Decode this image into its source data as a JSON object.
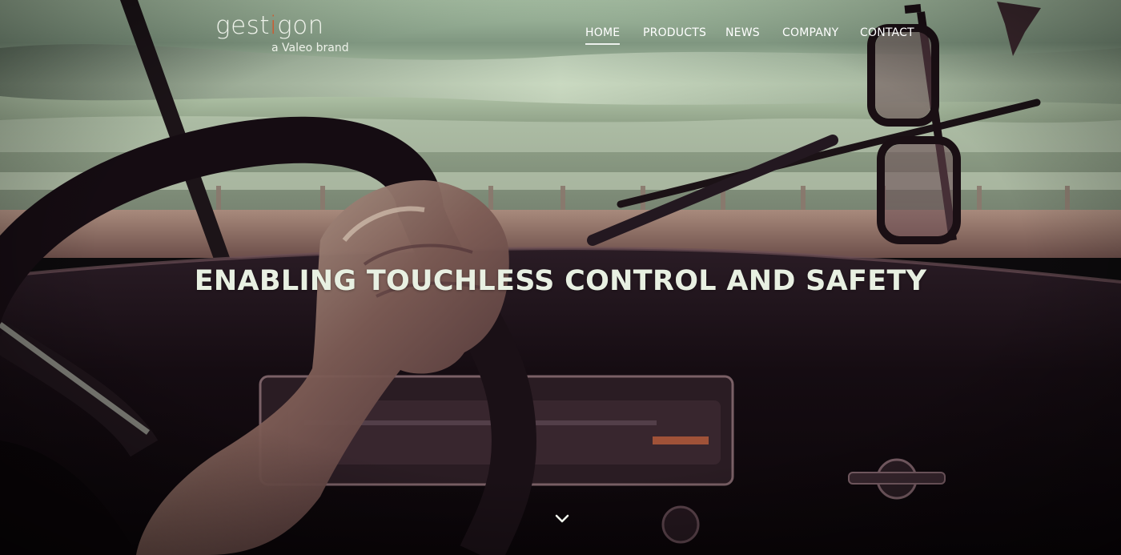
{
  "logo": {
    "word_start": "gest",
    "word_accent": "i",
    "word_end": "gon",
    "subtitle": "a Valeo brand"
  },
  "nav": {
    "items": [
      {
        "label": "HOME",
        "active": true
      },
      {
        "label": "PRODUCTS",
        "active": false
      },
      {
        "label": "NEWS",
        "active": false
      },
      {
        "label": "COMPANY",
        "active": false
      },
      {
        "label": "CONTACT",
        "active": false
      }
    ]
  },
  "hero": {
    "headline": "ENABLING TOUCHLESS CONTROL AND SAFETY",
    "background_description_icon": "car-interior-photo",
    "scroll_icon": "chevron-down-icon"
  },
  "colors": {
    "logo_accent": "#d2572b",
    "text": "#e8f0e2",
    "sky": "#9db59a",
    "dashboard": "#1a1016"
  }
}
